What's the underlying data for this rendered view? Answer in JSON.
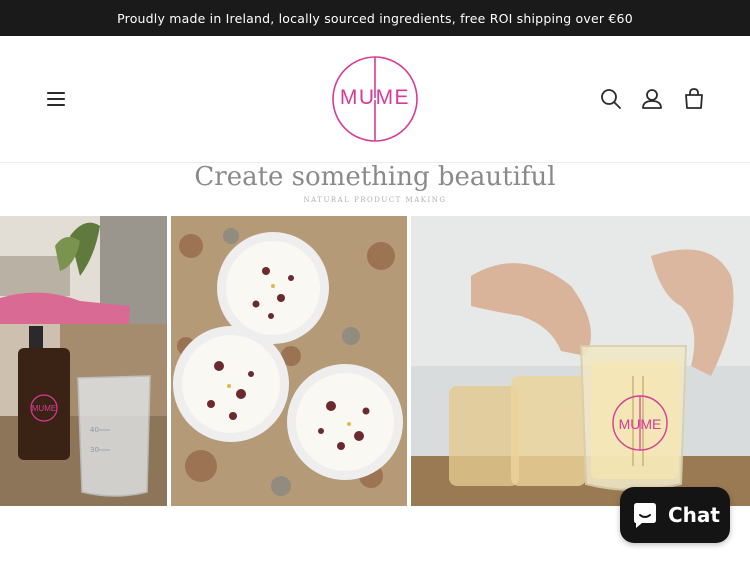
{
  "announcement": {
    "text": "Proudly made in Ireland, locally sourced ingredients, free ROI shipping over €60"
  },
  "header": {
    "logo_text": "MUME",
    "menu_icon": "menu-icon",
    "search_icon": "search-icon",
    "account_icon": "account-icon",
    "cart_icon": "cart-icon"
  },
  "hero": {
    "title": "Create something beautiful",
    "subtitle": "NATURAL PRODUCT MAKING"
  },
  "gallery": {
    "photos": [
      {
        "alt_subject": "amber bottle and measuring beaker"
      },
      {
        "alt_subject": "candles with dried flowers"
      },
      {
        "alt_subject": "hand holding candle glass"
      }
    ],
    "bottle_label": "MUME",
    "beaker_marks": [
      "40",
      "30"
    ],
    "glass_label": "MUME"
  },
  "chat": {
    "label": "Chat",
    "icon": "chat-bubble-icon"
  },
  "colors": {
    "brand": "#d63c96",
    "announcement_bg": "#1a1a1a",
    "chat_bg": "#141414",
    "headline": "#8a8a8a"
  }
}
